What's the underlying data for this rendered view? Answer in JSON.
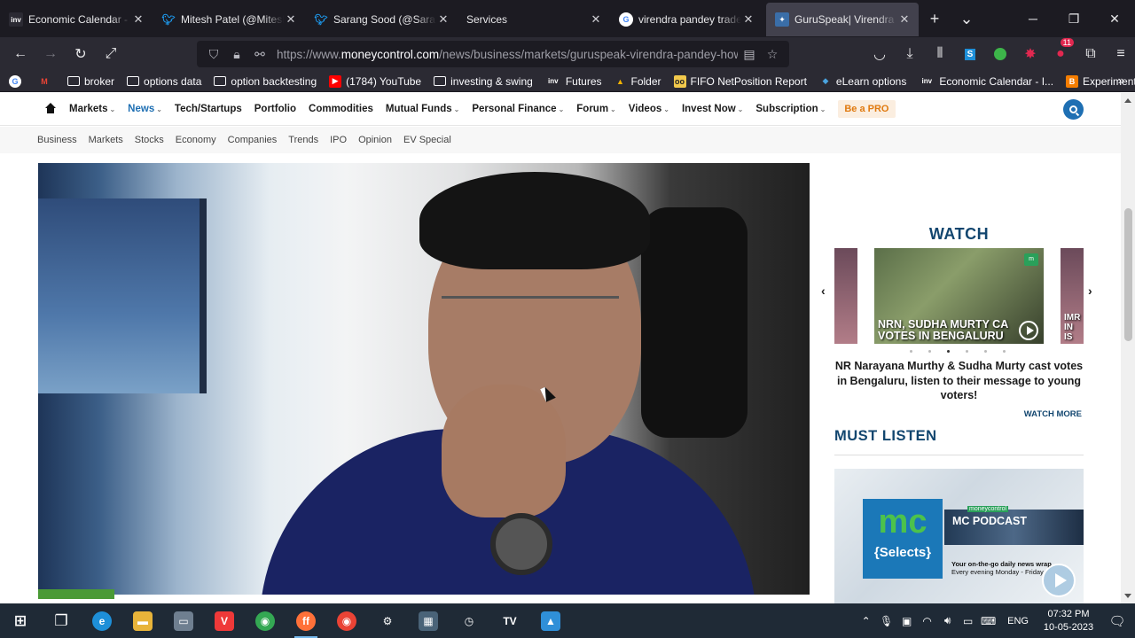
{
  "browser": {
    "tabs": [
      {
        "title": "Economic Calendar - Inv",
        "favicon": "inv-logo",
        "favcolor": "#2b2a33",
        "active": false
      },
      {
        "title": "Mitesh Patel (@Mitesh_I",
        "favicon": "twitter-icon",
        "favcolor": "#1d9bf0",
        "active": false
      },
      {
        "title": "Sarang Sood (@SarangS",
        "favicon": "twitter-icon",
        "favcolor": "#1d9bf0",
        "active": false
      },
      {
        "title": "Services",
        "favicon": "",
        "favcolor": "",
        "active": false
      },
      {
        "title": "virendra pandey trader -",
        "favicon": "google-icon",
        "favcolor": "#ffffff",
        "active": false
      },
      {
        "title": "GuruSpeak| Virendra Pa",
        "favicon": "moneycontrol-icon",
        "favcolor": "#3a6ea8",
        "active": true
      }
    ],
    "new_tab": "+",
    "url_domain": "moneycontrol.com",
    "url_prefix": "https://www.",
    "url_path": "/news/business/markets/guruspeak-virendra-pandey-how-t",
    "extensions_badge": "11",
    "bookmarks": [
      {
        "label": "",
        "icon": "google-icon"
      },
      {
        "label": "",
        "icon": "gmail-icon"
      },
      {
        "label": "broker",
        "icon": "folder-icon"
      },
      {
        "label": "options data",
        "icon": "folder-icon"
      },
      {
        "label": "option backtesting",
        "icon": "folder-icon"
      },
      {
        "label": "(1784) YouTube",
        "icon": "youtube-icon"
      },
      {
        "label": "investing & swing",
        "icon": "folder-icon"
      },
      {
        "label": "Futures",
        "icon": "inv-logo"
      },
      {
        "label": "Folder",
        "icon": "drive-icon"
      },
      {
        "label": "FIFO NetPosition Report",
        "icon": "fifo-icon"
      },
      {
        "label": "eLearn options",
        "icon": "elearn-icon"
      },
      {
        "label": "Economic Calendar - I...",
        "icon": "inv-logo"
      },
      {
        "label": "Experiments in Techni...",
        "icon": "blogger-icon"
      }
    ]
  },
  "site": {
    "main_nav": [
      {
        "label": "Markets",
        "caret": true,
        "active": false
      },
      {
        "label": "News",
        "caret": true,
        "active": true
      },
      {
        "label": "Tech/Startups",
        "caret": false,
        "active": false
      },
      {
        "label": "Portfolio",
        "caret": false,
        "active": false
      },
      {
        "label": "Commodities",
        "caret": false,
        "active": false
      },
      {
        "label": "Mutual Funds",
        "caret": true,
        "active": false
      },
      {
        "label": "Personal Finance",
        "caret": true,
        "active": false
      },
      {
        "label": "Forum",
        "caret": true,
        "active": false
      },
      {
        "label": "Videos",
        "caret": true,
        "active": false
      },
      {
        "label": "Invest Now",
        "caret": true,
        "active": false
      },
      {
        "label": "Subscription",
        "caret": true,
        "active": false
      }
    ],
    "pro_label": "Be a PRO",
    "sub_nav": [
      "Business",
      "Markets",
      "Stocks",
      "Economy",
      "Companies",
      "Trends",
      "IPO",
      "Opinion",
      "EV Special"
    ],
    "watch": {
      "heading": "WATCH",
      "thumb_caption_line1": "NRN, SUDHA MURTY CA",
      "thumb_caption_line2": "VOTES IN BENGALURU",
      "side_caption_line1": "IMR",
      "side_caption_line2": "IN IS",
      "thumb_badge": "m",
      "video_title": "NR Narayana Murthy & Sudha Murty cast votes in Bengaluru, listen to their message to young voters!",
      "watch_more": "WATCH MORE",
      "dot_count": 6,
      "active_dot": 2
    },
    "listen": {
      "heading": "MUST LISTEN",
      "logo_top": "mc",
      "logo_bottom": "{Selects}",
      "brand_small": "moneycontrol",
      "podcast_title": "MC PODCAST",
      "podcast_desc_1": "Your on-the-go daily news wrap",
      "podcast_desc_2": "Every evening Monday - Friday"
    },
    "accent": "#12466f",
    "nav_active_color": "#1e6fb3"
  },
  "taskbar": {
    "apps": [
      {
        "name": "start-icon",
        "bg": "#1f2a36",
        "glyph": "⊞",
        "active": false
      },
      {
        "name": "task-view-icon",
        "bg": "#1f2a36",
        "glyph": "❐",
        "active": false
      },
      {
        "name": "edge-icon",
        "bg": "#1e8fd8",
        "glyph": "e",
        "active": false
      },
      {
        "name": "file-explorer-icon",
        "bg": "#e8b43a",
        "glyph": "▬",
        "active": false
      },
      {
        "name": "laptop-icon",
        "bg": "#6f7f90",
        "glyph": "▭",
        "active": false
      },
      {
        "name": "vivaldi-icon",
        "bg": "#ef3939",
        "glyph": "V",
        "active": false
      },
      {
        "name": "chrome-icon",
        "bg": "#34a853",
        "glyph": "◉",
        "active": false
      },
      {
        "name": "firefox-icon",
        "bg": "#ff7139",
        "glyph": "ff",
        "active": true
      },
      {
        "name": "chrome-icon-2",
        "bg": "#ea4335",
        "glyph": "◉",
        "active": false
      },
      {
        "name": "settings-icon",
        "bg": "#1f2a36",
        "glyph": "⚙",
        "active": false
      },
      {
        "name": "calculator-icon",
        "bg": "#4a6378",
        "glyph": "▦",
        "active": false
      },
      {
        "name": "speedometer-icon",
        "bg": "#1f2a36",
        "glyph": "◷",
        "active": false
      },
      {
        "name": "tradingview-icon",
        "bg": "#1f2a36",
        "glyph": "TV",
        "active": false
      },
      {
        "name": "photos-icon",
        "bg": "#2f8fd8",
        "glyph": "▲",
        "active": false
      }
    ],
    "lang": "ENG",
    "time": "07:32 PM",
    "date": "10-05-2023"
  }
}
